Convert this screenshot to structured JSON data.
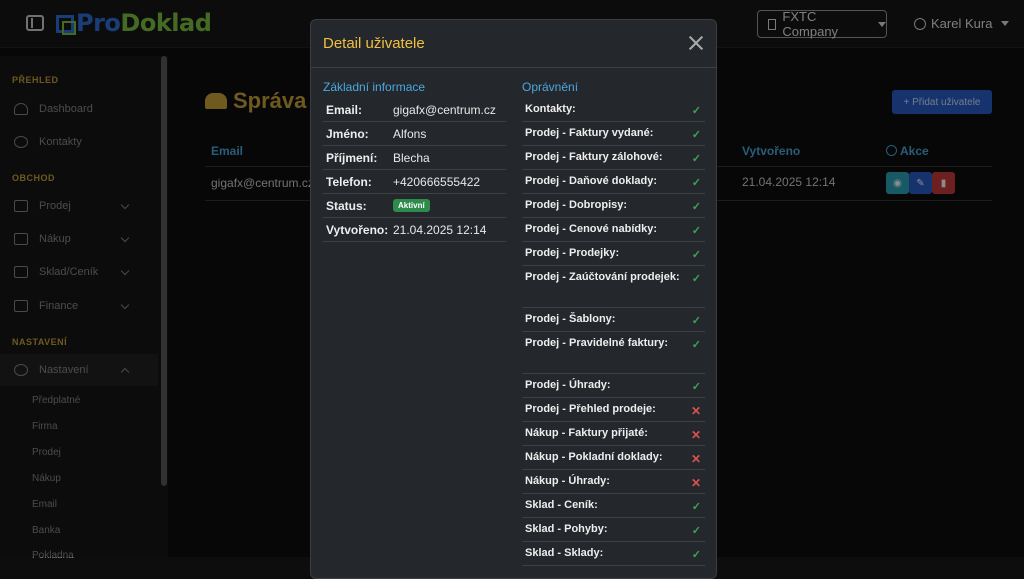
{
  "app": {
    "logo_part1": "Pro",
    "logo_part2": "Doklad"
  },
  "header": {
    "company": "FXTC Company",
    "user": "Karel Kura"
  },
  "sidebar": {
    "sections": [
      "PŘEHLED",
      "OBCHOD",
      "NASTAVENÍ"
    ],
    "items": [
      "Dashboard",
      "Kontakty",
      "Prodej",
      "Nákup",
      "Sklad/Ceník",
      "Finance",
      "Nastavení"
    ],
    "subitems": [
      "Předplatné",
      "Firma",
      "Prodej",
      "Nákup",
      "Email",
      "Banka",
      "Pokladna"
    ]
  },
  "page": {
    "title": "Správa",
    "add_button": "+ Přidat uživatele",
    "columns": {
      "email": "Email",
      "created": "Vytvořeno",
      "actions": "Akce"
    },
    "row": {
      "email": "gigafx@centrum.cz",
      "created": "21.04.2025 12:14"
    }
  },
  "modal": {
    "title": "Detail uživatele",
    "basic_title": "Základní informace",
    "perm_title": "Oprávnění",
    "info": [
      {
        "k": "Email:",
        "v": "gigafx@centrum.cz"
      },
      {
        "k": "Jméno:",
        "v": "Alfons"
      },
      {
        "k": "Příjmení:",
        "v": "Blecha"
      },
      {
        "k": "Telefon:",
        "v": "+420666555422"
      },
      {
        "k": "Status:",
        "v": "Aktivní"
      },
      {
        "k": "Vytvořeno:",
        "v": "21.04.2025 12:14"
      }
    ],
    "permissions": [
      {
        "label": "Kontakty:",
        "allowed": true
      },
      {
        "label": "Prodej - Faktury vydané:",
        "allowed": true
      },
      {
        "label": "Prodej - Faktury zálohové:",
        "allowed": true
      },
      {
        "label": "Prodej - Daňové doklady:",
        "allowed": true
      },
      {
        "label": "Prodej - Dobropisy:",
        "allowed": true
      },
      {
        "label": "Prodej - Cenové nabídky:",
        "allowed": true
      },
      {
        "label": "Prodej - Prodejky:",
        "allowed": true
      },
      {
        "label": "Prodej - Zaúčtování prodejek:",
        "allowed": true
      },
      {
        "label": "Prodej - Šablony:",
        "allowed": true
      },
      {
        "label": "Prodej - Pravidelné faktury:",
        "allowed": true
      },
      {
        "label": "Prodej - Úhrady:",
        "allowed": true
      },
      {
        "label": "Prodej - Přehled prodeje:",
        "allowed": false
      },
      {
        "label": "Nákup - Faktury přijaté:",
        "allowed": false
      },
      {
        "label": "Nákup - Pokladní doklady:",
        "allowed": false
      },
      {
        "label": "Nákup - Úhrady:",
        "allowed": false
      },
      {
        "label": "Sklad - Ceník:",
        "allowed": true
      },
      {
        "label": "Sklad - Pohyby:",
        "allowed": true
      },
      {
        "label": "Sklad - Sklady:",
        "allowed": true
      }
    ]
  },
  "colors": {
    "accent": "#f0c040",
    "link": "#4aa9e0",
    "ok": "#3fa35a",
    "deny": "#d9534f"
  }
}
